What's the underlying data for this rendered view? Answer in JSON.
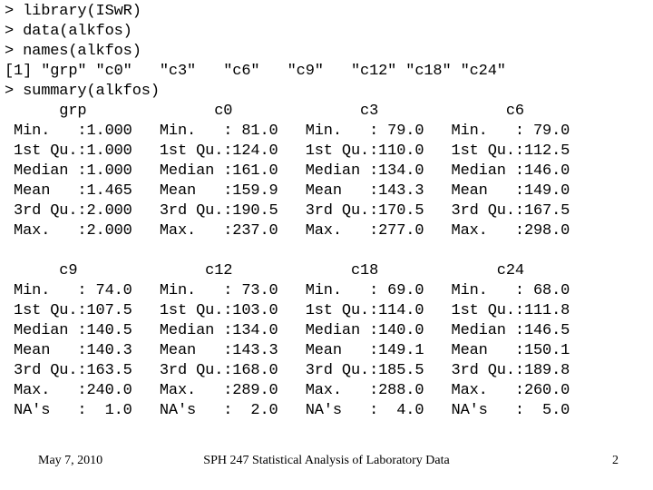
{
  "slide": {
    "background_color": "#ffffff",
    "text_color": "#000000"
  },
  "console": {
    "lines": [
      "> library(ISwR)",
      "> data(alkfos)",
      "> names(alkfos)",
      "[1] \"grp\" \"c0\"   \"c3\"   \"c6\"   \"c9\"   \"c12\" \"c18\" \"c24\"",
      "> summary(alkfos)",
      "      grp              c0              c3              c6       ",
      " Min.   :1.000   Min.   : 81.0   Min.   : 79.0   Min.   : 79.0  ",
      " 1st Qu.:1.000   1st Qu.:124.0   1st Qu.:110.0   1st Qu.:112.5  ",
      " Median :1.000   Median :161.0   Median :134.0   Median :146.0  ",
      " Mean   :1.465   Mean   :159.9   Mean   :143.3   Mean   :149.0  ",
      " 3rd Qu.:2.000   3rd Qu.:190.5   3rd Qu.:170.5   3rd Qu.:167.5  ",
      " Max.   :2.000   Max.   :237.0   Max.   :277.0   Max.   :298.0  ",
      "",
      "      c9              c12             c18             c24       ",
      " Min.   : 74.0   Min.   : 73.0   Min.   : 69.0   Min.   : 68.0  ",
      " 1st Qu.:107.5   1st Qu.:103.0   1st Qu.:114.0   1st Qu.:111.8  ",
      " Median :140.5   Median :134.0   Median :140.0   Median :146.5  ",
      " Mean   :140.3   Mean   :143.3   Mean   :149.1   Mean   :150.1  ",
      " 3rd Qu.:163.5   3rd Qu.:168.0   3rd Qu.:185.5   3rd Qu.:189.8  ",
      " Max.   :240.0   Max.   :289.0   Max.   :288.0   Max.   :260.0  ",
      " NA's   :  1.0   NA's   :  2.0   NA's   :  4.0   NA's   :  5.0  "
    ]
  },
  "summary_tables": [
    {
      "columns": [
        "grp",
        "c0",
        "c3",
        "c6"
      ],
      "stats": [
        "Min.",
        "1st Qu.",
        "Median",
        "Mean",
        "3rd Qu.",
        "Max."
      ],
      "values": {
        "grp": [
          "1.000",
          "1.000",
          "1.000",
          "1.465",
          "2.000",
          "2.000"
        ],
        "c0": [
          "81.0",
          "124.0",
          "161.0",
          "159.9",
          "190.5",
          "237.0"
        ],
        "c3": [
          "79.0",
          "110.0",
          "134.0",
          "143.3",
          "170.5",
          "277.0"
        ],
        "c6": [
          "79.0",
          "112.5",
          "146.0",
          "149.0",
          "167.5",
          "298.0"
        ]
      }
    },
    {
      "columns": [
        "c9",
        "c12",
        "c18",
        "c24"
      ],
      "stats": [
        "Min.",
        "1st Qu.",
        "Median",
        "Mean",
        "3rd Qu.",
        "Max.",
        "NA's"
      ],
      "values": {
        "c9": [
          "74.0",
          "107.5",
          "140.5",
          "140.3",
          "163.5",
          "240.0",
          "1.0"
        ],
        "c12": [
          "73.0",
          "103.0",
          "134.0",
          "143.3",
          "168.0",
          "289.0",
          "2.0"
        ],
        "c18": [
          "69.0",
          "114.0",
          "140.0",
          "149.1",
          "185.5",
          "288.0",
          "4.0"
        ],
        "c24": [
          "68.0",
          "111.8",
          "146.5",
          "150.1",
          "189.8",
          "260.0",
          "5.0"
        ]
      }
    }
  ],
  "footer": {
    "date": "May 7, 2010",
    "title": "SPH 247 Statistical Analysis of Laboratory Data",
    "page_number": "2"
  }
}
